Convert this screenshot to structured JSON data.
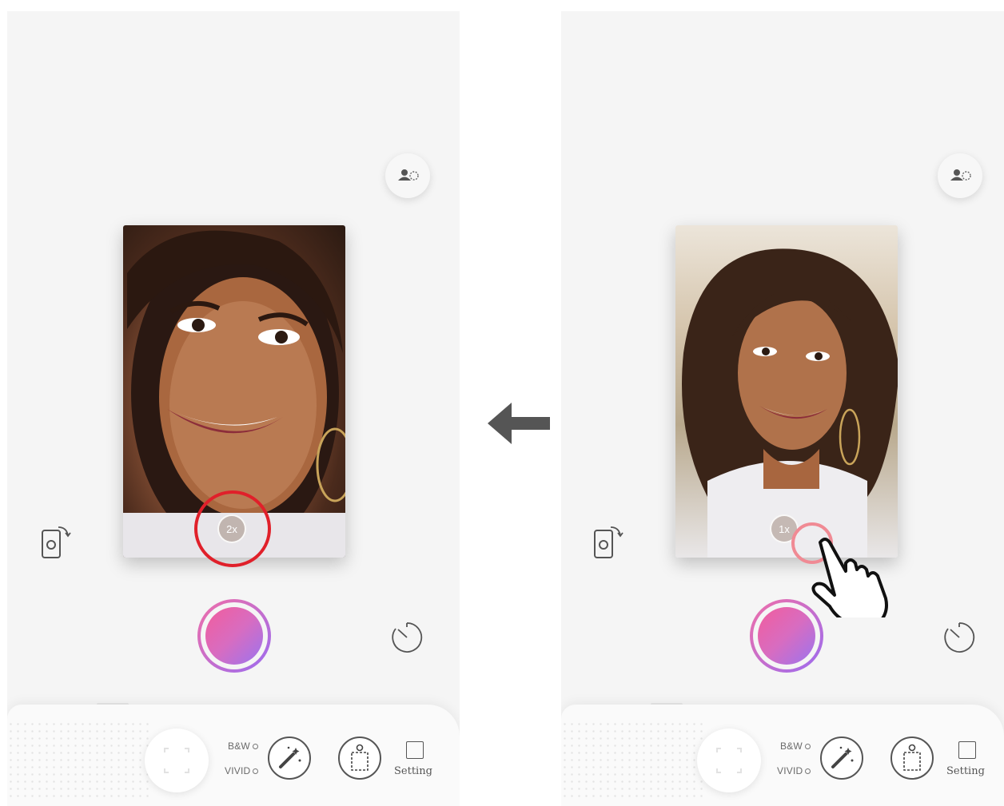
{
  "left_screen": {
    "zoom_label": "2x",
    "modes": {
      "bw_label": "B&W",
      "vivid_label": "VIVID"
    },
    "setting_label": "Setting"
  },
  "right_screen": {
    "zoom_label": "1x",
    "modes": {
      "bw_label": "B&W",
      "vivid_label": "VIVID"
    },
    "setting_label": "Setting"
  },
  "annotations": {
    "highlight_color": "#e0202a",
    "tap_color": "#f08a94",
    "arrow_color": "#555555"
  },
  "theme": {
    "shutter_gradient": [
      "#f25d9c",
      "#9b74ef"
    ],
    "screen_bg": "#f5f5f5"
  }
}
